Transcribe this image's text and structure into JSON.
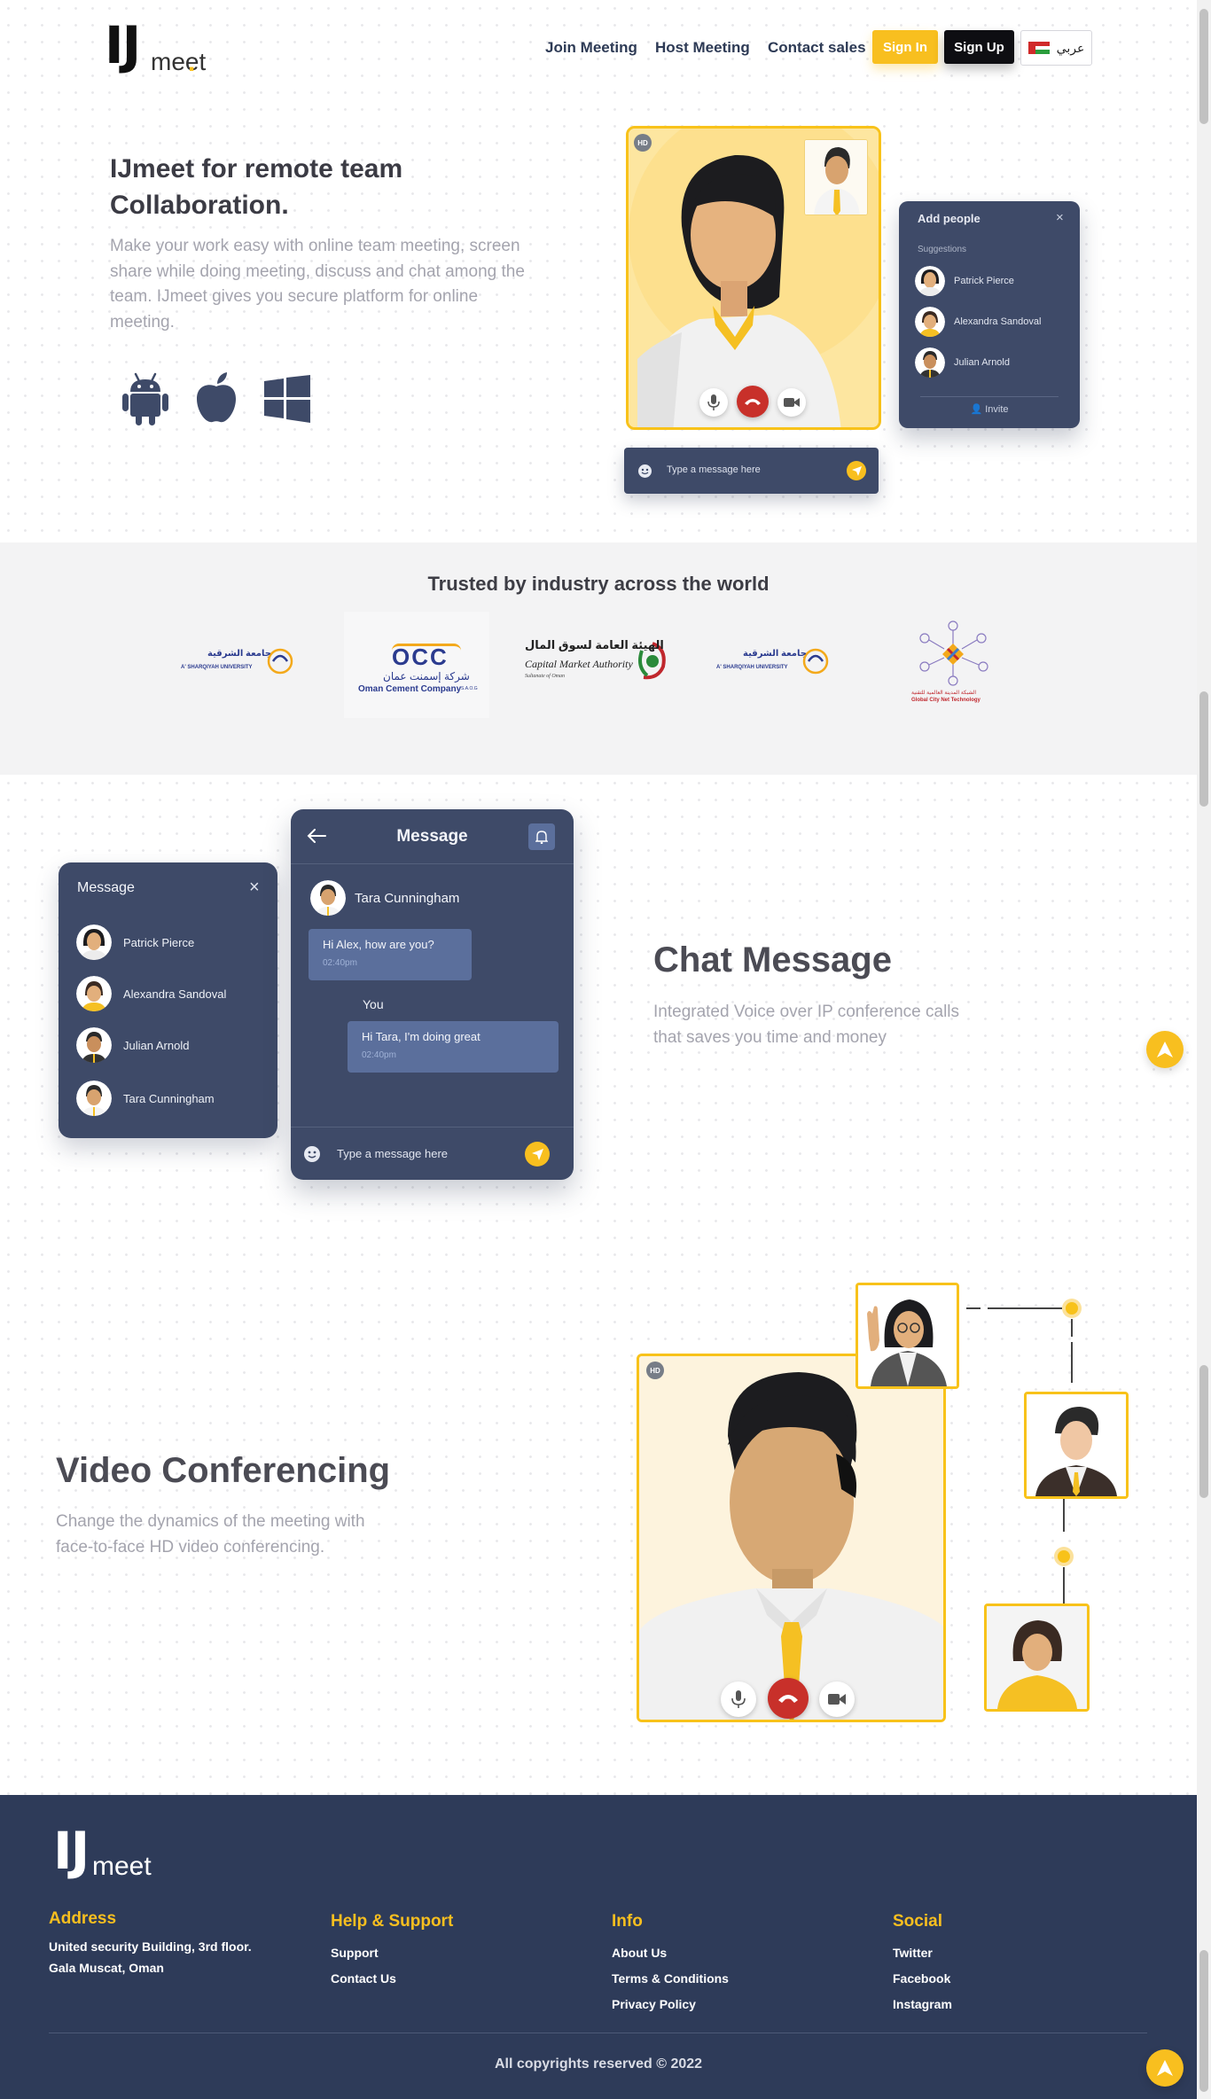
{
  "header": {
    "logo": {
      "letters": "IJ",
      "word": "meet",
      "dot": "."
    },
    "nav": [
      {
        "label": "Join Meeting"
      },
      {
        "label": "Host Meeting"
      },
      {
        "label": "Contact sales"
      }
    ],
    "sign_in": "Sign In",
    "sign_up": "Sign Up",
    "language": "عربي"
  },
  "hero": {
    "title": "IJmeet for remote team Collaboration.",
    "description": "Make your work easy with online team meeting, screen share while doing meeting, discuss and chat among the team. IJmeet gives you secure platform for online meeting.",
    "platforms": [
      "android-icon",
      "apple-icon",
      "windows-icon"
    ],
    "hd_badge": "HD",
    "add_people": {
      "title": "Add people",
      "suggestions_label": "Suggestions",
      "people": [
        "Patrick Pierce",
        "Alexandra Sandoval",
        "Julian Arnold"
      ],
      "invite": "Invite"
    },
    "message_placeholder": "Type a message here"
  },
  "trusted": {
    "title": "Trusted by industry across the world",
    "partners": [
      {
        "name": "A' SHARQIYAH UNIVERSITY",
        "arabic": "جامعة الشرقية"
      },
      {
        "name": "Oman Cement Company",
        "arabic": "شركة إسمنت عمان",
        "abbr": "OCC",
        "suffix": "S.A.O.G"
      },
      {
        "name": "Capital Market Authority",
        "arabic": "الهيئة العامة لسوق المال",
        "sub": "Sultanate of Oman"
      },
      {
        "name": "A' SHARQIYAH UNIVERSITY",
        "arabic": "جامعة الشرقية"
      },
      {
        "name": "Global City Net Technology",
        "arabic": "الشبكة المدينة العالمية للتقنية"
      }
    ]
  },
  "chat": {
    "list": {
      "title": "Message",
      "people": [
        "Patrick Pierce",
        "Alexandra Sandoval",
        "Julian Arnold",
        "Tara Cunningham"
      ]
    },
    "window": {
      "title": "Message",
      "contact": "Tara Cunningham",
      "incoming": {
        "text": "Hi Alex, how are you?",
        "time": "02:40pm"
      },
      "you_label": "You",
      "outgoing": {
        "text": "Hi Tara, I'm doing great",
        "time": "02:40pm"
      },
      "placeholder": "Type a message here"
    },
    "heading": "Chat Message",
    "description": "Integrated Voice over IP conference calls that saves you time and money"
  },
  "video": {
    "heading": "Video Conferencing",
    "description": "Change the dynamics of the meeting with face-to-face HD video conferencing.",
    "hd_badge": "HD"
  },
  "footer": {
    "logo": {
      "letters": "IJ",
      "word": "meet",
      "dot": "."
    },
    "address": {
      "heading": "Address",
      "line1": "United security Building, 3rd floor.",
      "line2": "Gala Muscat, Oman"
    },
    "help": {
      "heading": "Help & Support",
      "links": [
        "Support",
        "Contact Us"
      ]
    },
    "info": {
      "heading": "Info",
      "links": [
        "About Us",
        "Terms & Conditions",
        "Privacy Policy"
      ]
    },
    "social": {
      "heading": "Social",
      "links": [
        "Twitter",
        "Facebook",
        "Instagram"
      ]
    },
    "copyright": "All copyrights reserved © 2022"
  },
  "colors": {
    "accent": "#f8bf1f",
    "navy": "#2e3b59",
    "card": "#3e4a68",
    "call_red": "#c8302a"
  }
}
